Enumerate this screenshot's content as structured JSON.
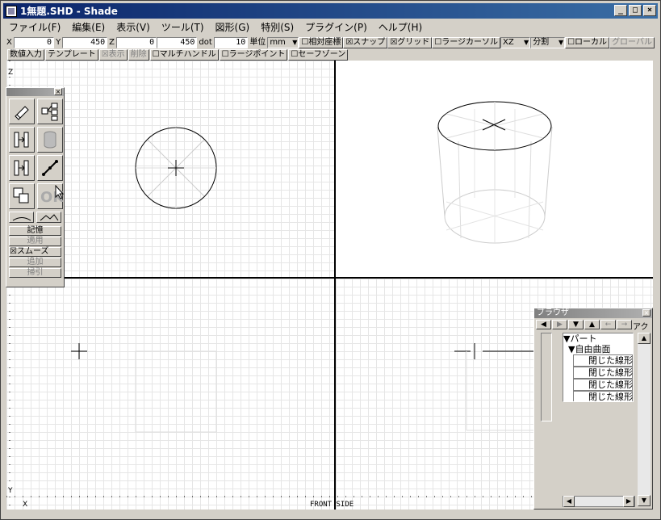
{
  "window": {
    "title": "1無題.SHD - Shade",
    "minimize": "_",
    "maximize": "□",
    "close": "×"
  },
  "menu": [
    "ファイル(F)",
    "編集(E)",
    "表示(V)",
    "ツール(T)",
    "図形(G)",
    "特別(S)",
    "プラグイン(P)",
    "ヘルプ(H)"
  ],
  "coords": {
    "x_label": "X",
    "x_value": "0",
    "y_label": "Y",
    "y_value": "450",
    "z_label": "Z",
    "z_value": "0",
    "dot_value": "450",
    "dot_label": "dot",
    "unit_value": "10",
    "unit_label": "単位",
    "unit_select": "mm",
    "relative": "☐相対座標",
    "snap": "☒スナップ",
    "grid": "☒グリッド",
    "large_cursor": "☐ラージカーソル",
    "plane_select": "XZ",
    "split_select": "分割",
    "local": "☐ローカル",
    "global": "グローバル"
  },
  "toolbar2": {
    "numeric": "数値入力",
    "template": "テンプレート",
    "show": "☒表示",
    "delete": "削除",
    "multi_handle": "☐マルチハンドル",
    "large_point": "☐ラージポイント",
    "safe_zone": "☐セーフゾーン"
  },
  "palette": {
    "close": "×",
    "memory": "記憶",
    "apply": "適用",
    "smooth": "☒スムーズ",
    "add": "追加",
    "subtract": "掃引"
  },
  "viewport": {
    "z_axis": "Z",
    "y_axis": "Y",
    "x_axis": "X",
    "view_label": "FRONT SIDE"
  },
  "browser": {
    "title": "ブラウザ",
    "close": "×",
    "extra": "アク",
    "tree": [
      "▼パート",
      "▼自由曲面",
      "閉じた線形",
      "閉じた線形",
      "閉じた線形",
      "閉じた線形"
    ]
  }
}
